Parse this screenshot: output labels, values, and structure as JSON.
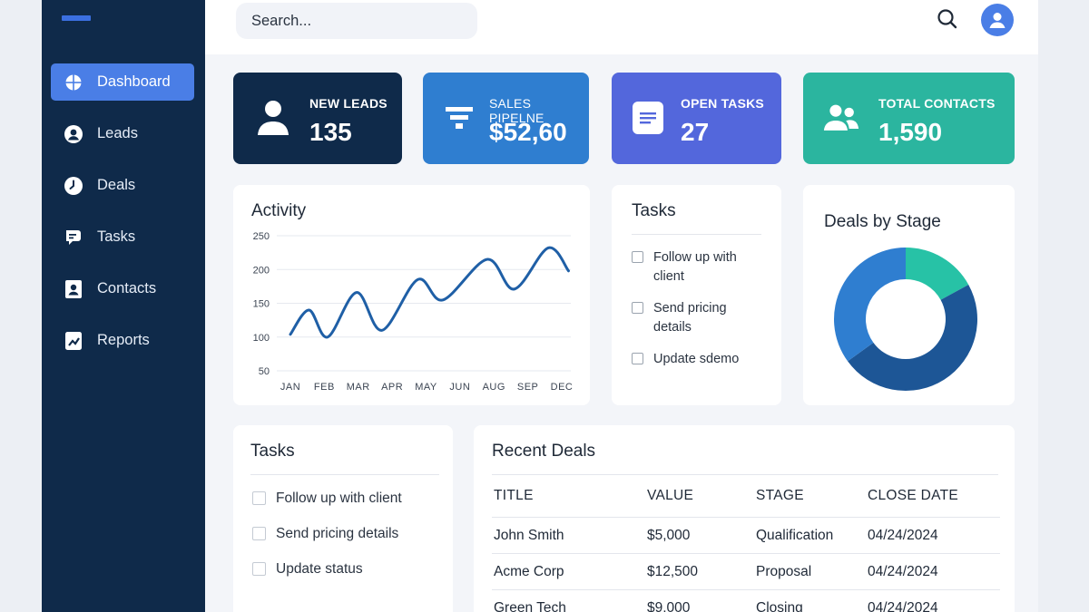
{
  "search": {
    "placeholder": "Search..."
  },
  "sidebar": {
    "items": [
      {
        "label": "Dashboard",
        "icon": "dashboard-icon",
        "active": true
      },
      {
        "label": "Leads",
        "icon": "user-circle-icon"
      },
      {
        "label": "Deals",
        "icon": "clock-icon"
      },
      {
        "label": "Tasks",
        "icon": "chat-icon"
      },
      {
        "label": "Contacts",
        "icon": "contact-card-icon"
      },
      {
        "label": "Reports",
        "icon": "report-icon"
      }
    ]
  },
  "stats": [
    {
      "label": "NEW LEADS",
      "value": "135",
      "color": "#0f2a4a",
      "icon": "person-icon"
    },
    {
      "label": "SALES PIPELNE",
      "value": "$52,60",
      "color": "#2f7ed0",
      "icon": "funnel-icon"
    },
    {
      "label": "OPEN TASKS",
      "value": "27",
      "color": "#5367dc",
      "icon": "document-icon"
    },
    {
      "label": "TOTAL CONTACTS",
      "value": "1,590",
      "color": "#2bb59f",
      "icon": "people-icon"
    }
  ],
  "activity": {
    "title": "Activity",
    "chart_data": {
      "type": "line",
      "categories": [
        "JAN",
        "FEB",
        "MAR",
        "APR",
        "MAY",
        "JUN",
        "AUG",
        "SEP",
        "DEC"
      ],
      "x_ticks": [
        "JAN",
        "FEB",
        "MAR",
        "APR",
        "MAY",
        "JUN",
        "AUG",
        "SEP",
        "DEC"
      ],
      "y_ticks": [
        50,
        100,
        150,
        200,
        250
      ],
      "ylim": [
        50,
        250
      ],
      "series": [
        {
          "color": "#1f5fa6",
          "points": [
            [
              0,
              104
            ],
            [
              0.55,
              140
            ],
            [
              1.1,
              100
            ],
            [
              1.95,
              166
            ],
            [
              2.7,
              110
            ],
            [
              3.75,
              185
            ],
            [
              4.5,
              155
            ],
            [
              5.8,
              215
            ],
            [
              6.6,
              171
            ],
            [
              7.6,
              232
            ],
            [
              8.2,
              198
            ]
          ]
        }
      ],
      "grid": true
    }
  },
  "tasks_small": {
    "title": "Tasks",
    "items": [
      {
        "line1": "Follow up with",
        "line2": "client"
      },
      {
        "line1": "Send pricing",
        "line2": "details"
      },
      {
        "line1": "Update sdemo",
        "line2": ""
      }
    ]
  },
  "deals_by_stage": {
    "title": "Deals by Stage",
    "chart_data": {
      "type": "pie",
      "donut": true,
      "slices": [
        {
          "value": 17,
          "color": "#27c2a6"
        },
        {
          "value": 48,
          "color": "#1d5696"
        },
        {
          "value": 35,
          "color": "#2f7ed0"
        }
      ]
    }
  },
  "tasks_big": {
    "title": "Tasks",
    "items": [
      "Follow up with client",
      "Send pricing details",
      "Update status"
    ]
  },
  "recent_deals": {
    "title": "Recent Deals",
    "columns": [
      "TITLE",
      "VALUE",
      "STAGE",
      "CLOSE DATE"
    ],
    "rows": [
      [
        "John Smith",
        "$5,000",
        "Qualification",
        "04/24/2024"
      ],
      [
        "Acme Corp",
        "$12,500",
        "Proposal",
        "04/24/2024"
      ],
      [
        "Green Tech",
        "$9,000",
        "Closing",
        "04/24/2024"
      ]
    ]
  }
}
